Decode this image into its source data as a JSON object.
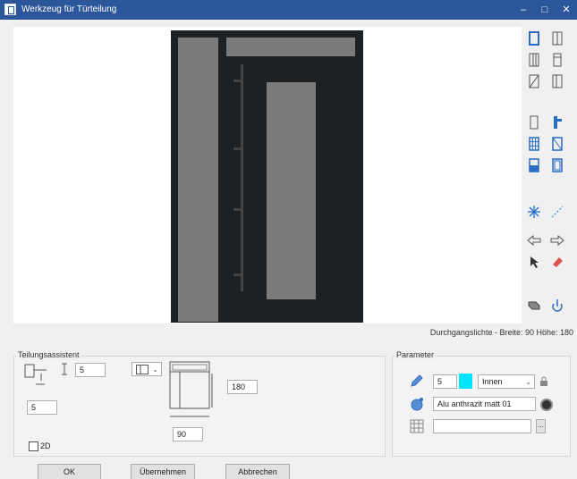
{
  "window": {
    "title": "Werkzeug für Türteilung",
    "min": "–",
    "max": "□",
    "close": "✕"
  },
  "dimension_text": "Durchgangslichte - Breite: 90 Höhe: 180",
  "teilungsassistent": {
    "label": "Teilungsassistent",
    "profile_value": "5",
    "offset_value": "5",
    "height_value": "180",
    "width_value": "90",
    "checkbox_2d_label": "2D"
  },
  "parameter": {
    "label": "Parameter",
    "pen_value": "5",
    "color_swatch": "#00e5ff",
    "side_value": "Innen",
    "material_value": "Alu anthrazit matt 01",
    "surface_value": "",
    "more_label": "..."
  },
  "buttons": {
    "ok": "OK",
    "apply": "Übernehmen",
    "cancel": "Abbrechen"
  },
  "toolbar_icons": [
    "frame-icon",
    "split-frame-icon",
    "vertical-split-icon",
    "door-leaf-icon",
    "diagonal-split-icon",
    "door-swing-icon",
    "door-outline-icon",
    "handle-icon",
    "grid-split-icon",
    "glass-diagonal-icon",
    "bottom-panel-icon",
    "panel-icon",
    "snowflake-icon",
    "dimension-line-icon",
    "arrow-left-icon",
    "arrow-right-icon",
    "pointer-icon",
    "eraser-icon",
    "3d-box-icon",
    "rotate-icon"
  ]
}
